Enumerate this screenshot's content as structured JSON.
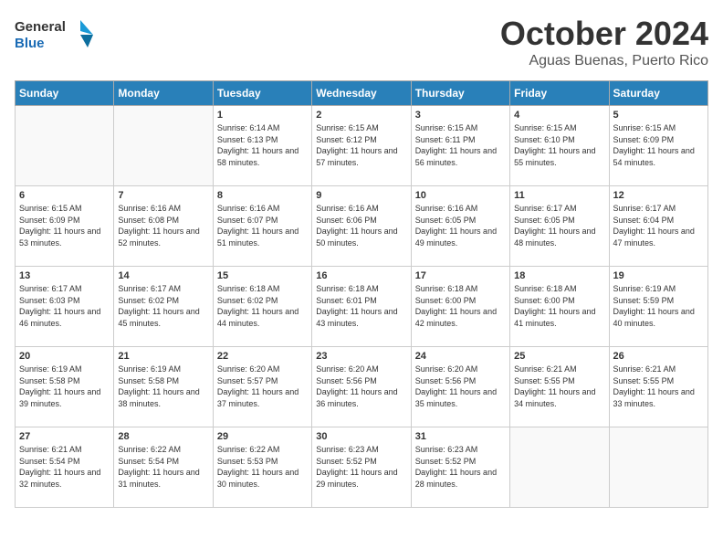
{
  "header": {
    "logo_line1": "General",
    "logo_line2": "Blue",
    "month": "October 2024",
    "location": "Aguas Buenas, Puerto Rico"
  },
  "weekdays": [
    "Sunday",
    "Monday",
    "Tuesday",
    "Wednesday",
    "Thursday",
    "Friday",
    "Saturday"
  ],
  "weeks": [
    [
      {
        "day": "",
        "empty": true
      },
      {
        "day": "",
        "empty": true
      },
      {
        "day": "1",
        "sunrise": "6:14 AM",
        "sunset": "6:13 PM",
        "daylight": "11 hours and 58 minutes."
      },
      {
        "day": "2",
        "sunrise": "6:15 AM",
        "sunset": "6:12 PM",
        "daylight": "11 hours and 57 minutes."
      },
      {
        "day": "3",
        "sunrise": "6:15 AM",
        "sunset": "6:11 PM",
        "daylight": "11 hours and 56 minutes."
      },
      {
        "day": "4",
        "sunrise": "6:15 AM",
        "sunset": "6:10 PM",
        "daylight": "11 hours and 55 minutes."
      },
      {
        "day": "5",
        "sunrise": "6:15 AM",
        "sunset": "6:09 PM",
        "daylight": "11 hours and 54 minutes."
      }
    ],
    [
      {
        "day": "6",
        "sunrise": "6:15 AM",
        "sunset": "6:09 PM",
        "daylight": "11 hours and 53 minutes."
      },
      {
        "day": "7",
        "sunrise": "6:16 AM",
        "sunset": "6:08 PM",
        "daylight": "11 hours and 52 minutes."
      },
      {
        "day": "8",
        "sunrise": "6:16 AM",
        "sunset": "6:07 PM",
        "daylight": "11 hours and 51 minutes."
      },
      {
        "day": "9",
        "sunrise": "6:16 AM",
        "sunset": "6:06 PM",
        "daylight": "11 hours and 50 minutes."
      },
      {
        "day": "10",
        "sunrise": "6:16 AM",
        "sunset": "6:05 PM",
        "daylight": "11 hours and 49 minutes."
      },
      {
        "day": "11",
        "sunrise": "6:17 AM",
        "sunset": "6:05 PM",
        "daylight": "11 hours and 48 minutes."
      },
      {
        "day": "12",
        "sunrise": "6:17 AM",
        "sunset": "6:04 PM",
        "daylight": "11 hours and 47 minutes."
      }
    ],
    [
      {
        "day": "13",
        "sunrise": "6:17 AM",
        "sunset": "6:03 PM",
        "daylight": "11 hours and 46 minutes."
      },
      {
        "day": "14",
        "sunrise": "6:17 AM",
        "sunset": "6:02 PM",
        "daylight": "11 hours and 45 minutes."
      },
      {
        "day": "15",
        "sunrise": "6:18 AM",
        "sunset": "6:02 PM",
        "daylight": "11 hours and 44 minutes."
      },
      {
        "day": "16",
        "sunrise": "6:18 AM",
        "sunset": "6:01 PM",
        "daylight": "11 hours and 43 minutes."
      },
      {
        "day": "17",
        "sunrise": "6:18 AM",
        "sunset": "6:00 PM",
        "daylight": "11 hours and 42 minutes."
      },
      {
        "day": "18",
        "sunrise": "6:18 AM",
        "sunset": "6:00 PM",
        "daylight": "11 hours and 41 minutes."
      },
      {
        "day": "19",
        "sunrise": "6:19 AM",
        "sunset": "5:59 PM",
        "daylight": "11 hours and 40 minutes."
      }
    ],
    [
      {
        "day": "20",
        "sunrise": "6:19 AM",
        "sunset": "5:58 PM",
        "daylight": "11 hours and 39 minutes."
      },
      {
        "day": "21",
        "sunrise": "6:19 AM",
        "sunset": "5:58 PM",
        "daylight": "11 hours and 38 minutes."
      },
      {
        "day": "22",
        "sunrise": "6:20 AM",
        "sunset": "5:57 PM",
        "daylight": "11 hours and 37 minutes."
      },
      {
        "day": "23",
        "sunrise": "6:20 AM",
        "sunset": "5:56 PM",
        "daylight": "11 hours and 36 minutes."
      },
      {
        "day": "24",
        "sunrise": "6:20 AM",
        "sunset": "5:56 PM",
        "daylight": "11 hours and 35 minutes."
      },
      {
        "day": "25",
        "sunrise": "6:21 AM",
        "sunset": "5:55 PM",
        "daylight": "11 hours and 34 minutes."
      },
      {
        "day": "26",
        "sunrise": "6:21 AM",
        "sunset": "5:55 PM",
        "daylight": "11 hours and 33 minutes."
      }
    ],
    [
      {
        "day": "27",
        "sunrise": "6:21 AM",
        "sunset": "5:54 PM",
        "daylight": "11 hours and 32 minutes."
      },
      {
        "day": "28",
        "sunrise": "6:22 AM",
        "sunset": "5:54 PM",
        "daylight": "11 hours and 31 minutes."
      },
      {
        "day": "29",
        "sunrise": "6:22 AM",
        "sunset": "5:53 PM",
        "daylight": "11 hours and 30 minutes."
      },
      {
        "day": "30",
        "sunrise": "6:23 AM",
        "sunset": "5:52 PM",
        "daylight": "11 hours and 29 minutes."
      },
      {
        "day": "31",
        "sunrise": "6:23 AM",
        "sunset": "5:52 PM",
        "daylight": "11 hours and 28 minutes."
      },
      {
        "day": "",
        "empty": true
      },
      {
        "day": "",
        "empty": true
      }
    ]
  ],
  "labels": {
    "sunrise": "Sunrise:",
    "sunset": "Sunset:",
    "daylight": "Daylight:"
  }
}
